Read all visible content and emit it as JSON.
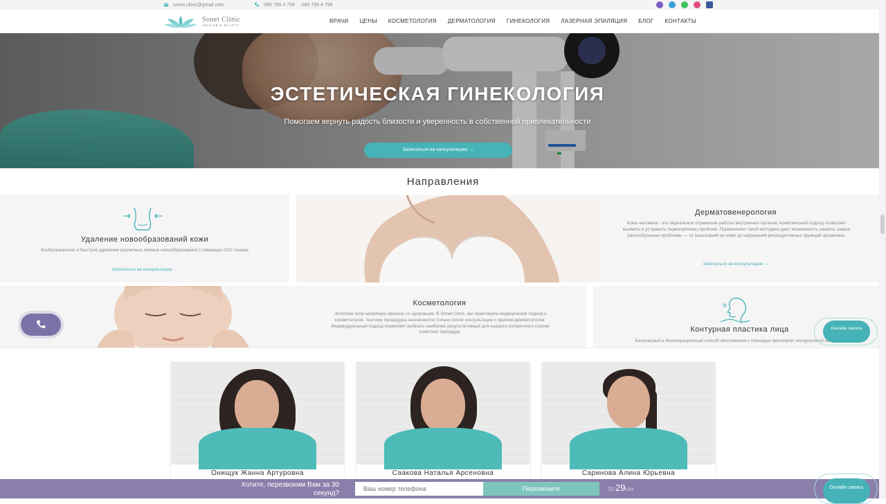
{
  "topbar": {
    "email": "sonet.clinic@gmail.com",
    "phone1": "098 799 4 799",
    "phone2": "093 799 4 799",
    "social": [
      "viber",
      "telegram",
      "whatsapp",
      "instagram",
      "facebook"
    ]
  },
  "logo": {
    "line1": "Sonet Clinic",
    "line2": "HEALTH & BEAUTY"
  },
  "nav": [
    "ВРАЧИ",
    "ЦЕНЫ",
    "КОСМЕТОЛОГИЯ",
    "ДЕРМАТОЛОГИЯ",
    "ГИНЕКОЛОГИЯ",
    "ЛАЗЕРНАЯ ЭПИЛЯЦИЯ",
    "БЛОГ",
    "КОНТАКТЫ"
  ],
  "hero": {
    "title": "ЭСТЕТИЧЕСКАЯ ГИНЕКОЛОГИЯ",
    "subtitle": "Помогаем вернуть радость близости и уверенность в собственной привлекательности",
    "cta": "Записаться на консультацию  →"
  },
  "directions": {
    "title": "Направления",
    "cards": [
      {
        "title": "Удаление новообразований кожи",
        "desc": "Безболезненное и быстрое удаление различных кожных новообразований с помощью CO2 лазера",
        "link": "Записаться на консультацию  →"
      },
      {
        "title": "Дерматовенерология",
        "desc": "Кожа человека - это зеркальное отражение работы внутренних органов. Комплексный подход позволяет выявить и устранить первопричины проблем. Применение такой методики дает возможность решить самые разнообразные проблемы — от высыпаний на коже до нарушений репродуктивных функций организма.",
        "link": "Записаться на консультацию  →"
      },
      {
        "title": "Косметология",
        "desc": "Эстетика тела напрямую связана со здоровьем. В Sonet Clinic, мы практикуем медицинский подход к косметологии, поэтому процедуры назначаются только после консультации с врачом-дерматологом. Индивидуальный подход позволяет выбрать наиболее результативный для каждого конкретного случая комплекс процедур."
      },
      {
        "title": "Контурная пластика лица",
        "desc": "Безопасный и безоперационный способ омоложения с помощью филлеров гиалуроновой кислоты"
      }
    ]
  },
  "widgets": {
    "online": "Онлайн запись"
  },
  "team": [
    {
      "name": "Онищук Жанна Артуровна"
    },
    {
      "name": "Саакова Наталья Арсеновна"
    },
    {
      "name": "Саринова Алина Юрьевна"
    }
  ],
  "callback": {
    "question": "Хотите, перезвоним Вам за 30 секунд?",
    "placeholder": "Ваш номер телефона",
    "button": "Перезвоните",
    "timer_prefix": "00:",
    "timer_value": "29",
    "timer_suffix": "сек"
  },
  "colors": {
    "accent": "#45b3b8",
    "purple": "#8a7fab",
    "card_bg": "#f5f5f5"
  }
}
